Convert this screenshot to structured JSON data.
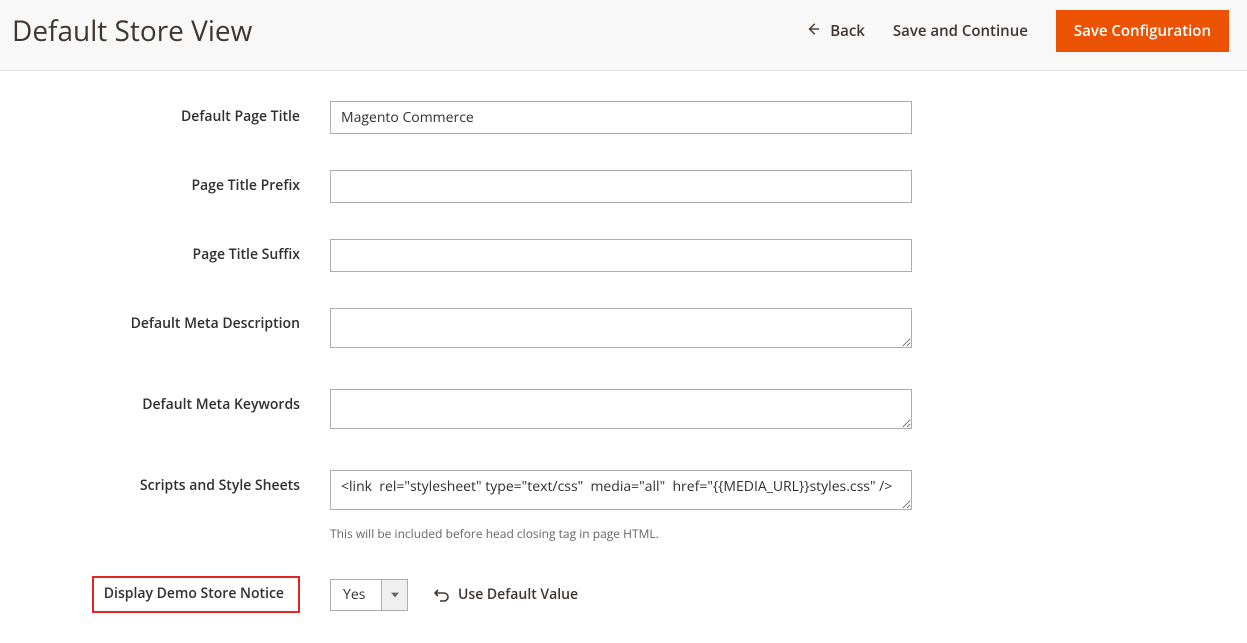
{
  "header": {
    "title": "Default Store View",
    "back_label": "Back",
    "save_continue_label": "Save and Continue",
    "save_config_label": "Save Configuration"
  },
  "fields": {
    "default_page_title": {
      "label": "Default Page Title",
      "value": "Magento Commerce"
    },
    "page_title_prefix": {
      "label": "Page Title Prefix",
      "value": ""
    },
    "page_title_suffix": {
      "label": "Page Title Suffix",
      "value": ""
    },
    "default_meta_description": {
      "label": "Default Meta Description",
      "value": ""
    },
    "default_meta_keywords": {
      "label": "Default Meta Keywords",
      "value": ""
    },
    "scripts_and_style_sheets": {
      "label": "Scripts and Style Sheets",
      "value": "<link  rel=\"stylesheet\" type=\"text/css\"  media=\"all\"  href=\"{{MEDIA_URL}}styles.css\" />",
      "note": "This will be included before head closing tag in page HTML."
    },
    "display_demo_store_notice": {
      "label": "Display Demo Store Notice",
      "value": "Yes",
      "use_default_label": "Use Default Value"
    }
  }
}
